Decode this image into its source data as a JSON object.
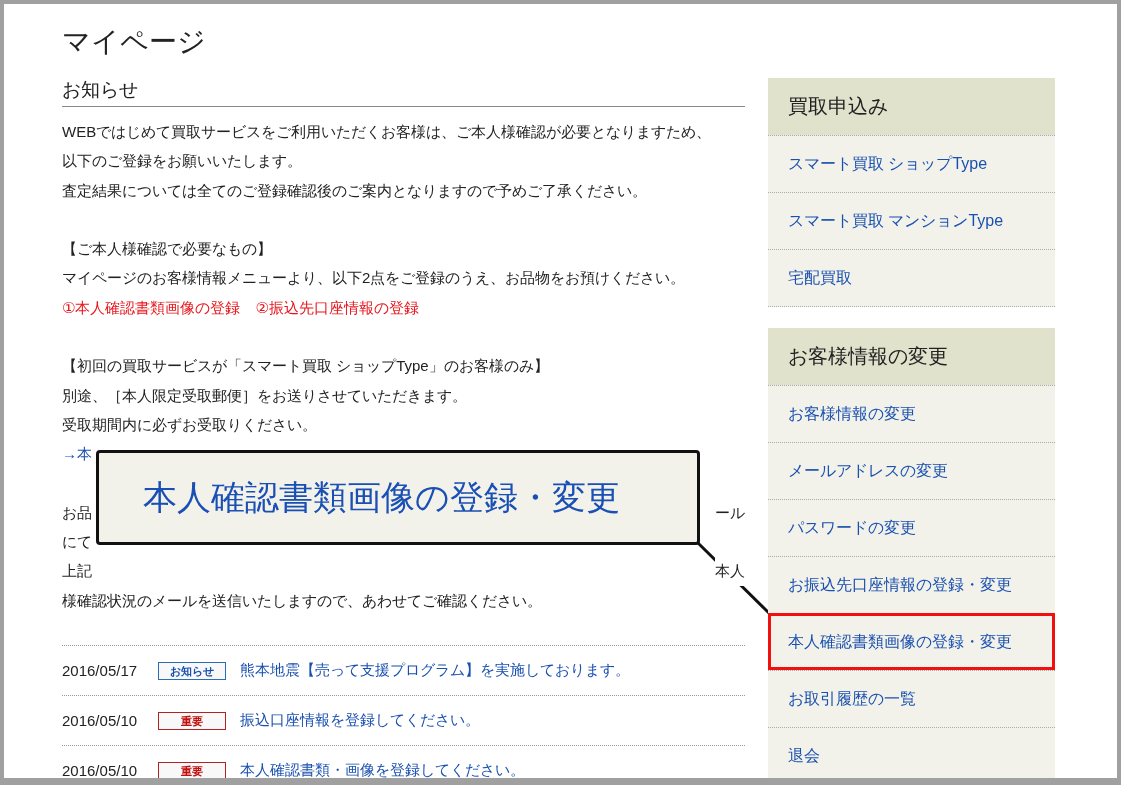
{
  "page_title": "マイページ",
  "notice": {
    "heading": "お知らせ",
    "lines": [
      {
        "kind": "text",
        "text": "WEBではじめて買取サービスをご利用いただくお客様は、ご本人様確認が必要となりますため、"
      },
      {
        "kind": "text",
        "text": "以下のご登録をお願いいたします。"
      },
      {
        "kind": "text",
        "text": "査定結果については全てのご登録確認後のご案内となりますので予めご了承ください。"
      },
      {
        "kind": "blank"
      },
      {
        "kind": "text",
        "text": "【ご本人様確認で必要なもの】"
      },
      {
        "kind": "text",
        "text": "マイページのお客様情報メニューより、以下2点をご登録のうえ、お品物をお預けください。"
      },
      {
        "kind": "alert",
        "text": "①本人確認書類画像の登録　②振込先口座情報の登録"
      },
      {
        "kind": "blank"
      },
      {
        "kind": "text",
        "text": "【初回の買取サービスが「スマート買取 ショップType」のお客様のみ】"
      },
      {
        "kind": "text",
        "text": "別途、［本人限定受取郵便］をお送りさせていただきます。"
      },
      {
        "kind": "text",
        "text": "受取期間内に必ずお受取りください。"
      },
      {
        "kind": "link",
        "text": "→本"
      },
      {
        "kind": "blank"
      },
      {
        "kind": "split",
        "left": "お品",
        "right": "ール"
      },
      {
        "kind": "text",
        "text": "にて"
      },
      {
        "kind": "split",
        "left": "上記",
        "right": "本人"
      },
      {
        "kind": "text",
        "text": "様確認状況のメールを送信いたしますので、あわせてご確認ください。"
      }
    ]
  },
  "news": [
    {
      "date": "2016/05/17",
      "tag": {
        "kind": "info",
        "label": "お知らせ"
      },
      "title": "熊本地震【売って支援プログラム】を実施しております。"
    },
    {
      "date": "2016/05/10",
      "tag": {
        "kind": "important",
        "label": "重要"
      },
      "title": "振込口座情報を登録してください。"
    },
    {
      "date": "2016/05/10",
      "tag": {
        "kind": "important",
        "label": "重要"
      },
      "title": "本人確認書類・画像を登録してください。"
    }
  ],
  "sidebar": {
    "sections": [
      {
        "heading": "買取申込み",
        "items": [
          {
            "label": "スマート買取 ショップType",
            "selected": false
          },
          {
            "label": "スマート買取 マンションType",
            "selected": false
          },
          {
            "label": "宅配買取",
            "selected": false
          }
        ]
      },
      {
        "heading": "お客様情報の変更",
        "items": [
          {
            "label": "お客様情報の変更",
            "selected": false
          },
          {
            "label": "メールアドレスの変更",
            "selected": false
          },
          {
            "label": "パスワードの変更",
            "selected": false
          },
          {
            "label": "お振込先口座情報の登録・変更",
            "selected": false
          },
          {
            "label": "本人確認書類画像の登録・変更",
            "selected": true
          },
          {
            "label": "お取引履歴の一覧",
            "selected": false
          },
          {
            "label": "退会",
            "selected": false
          }
        ]
      }
    ]
  },
  "callout": {
    "text": "本人確認書類画像の登録・変更"
  }
}
